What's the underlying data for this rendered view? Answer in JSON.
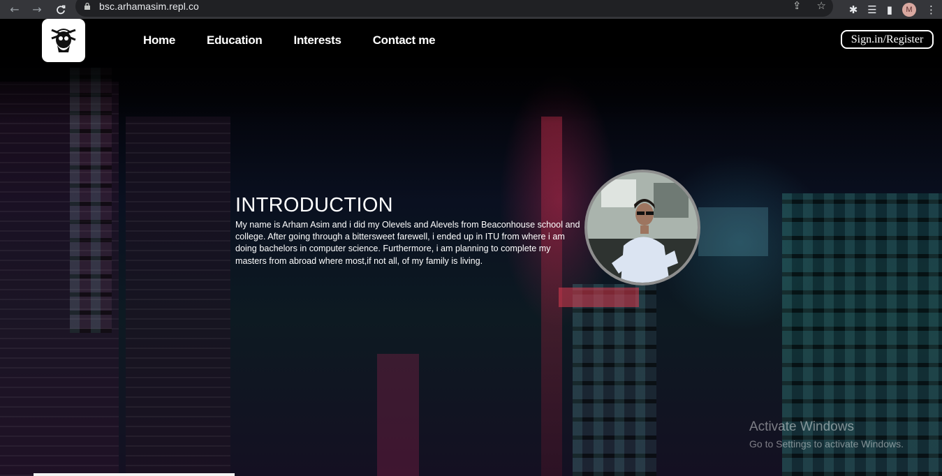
{
  "browser": {
    "url": "bsc.arhamasim.repl.co",
    "profile_initial": "M"
  },
  "nav": {
    "items": [
      {
        "label": "Home"
      },
      {
        "label": "Education"
      },
      {
        "label": "Interests"
      },
      {
        "label": "Contact me"
      }
    ],
    "signin_label": "Sign.in/Register"
  },
  "intro": {
    "heading": "INTRODUCTION",
    "body": "My name is Arham Asim and i did my Olevels and Alevels from Beaconhouse school and college. After going through a bittersweet farewell, i ended up in ITU from where i am doing bachelors in computer science. Furthermore, i am planning to complete my masters from abroad where most,if not all, of my family is living."
  },
  "watermark": {
    "title": "Activate Windows",
    "subtitle": "Go to Settings to activate Windows."
  },
  "colors": {
    "chrome_bg": "#35363a",
    "omnibox_bg": "#202124",
    "page_text": "#ffffff",
    "portrait_border": "#8e8e8e"
  }
}
